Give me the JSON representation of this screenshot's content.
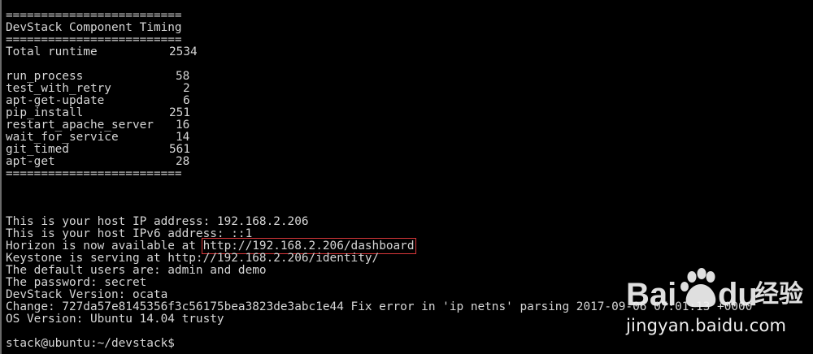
{
  "terminal": {
    "timing": {
      "rule": "=========================",
      "title": "DevStack Component Timing",
      "rows": [
        {
          "label": "Total runtime",
          "value": "2534"
        },
        {
          "label": "run_process",
          "value": "58"
        },
        {
          "label": "test_with_retry",
          "value": "2"
        },
        {
          "label": "apt-get-update",
          "value": "6"
        },
        {
          "label": "pip_install",
          "value": "251"
        },
        {
          "label": "restart_apache_server",
          "value": "16"
        },
        {
          "label": "wait_for_service",
          "value": "14"
        },
        {
          "label": "git_timed",
          "value": "561"
        },
        {
          "label": "apt-get",
          "value": "28"
        }
      ]
    },
    "info": {
      "host_ip": "This is your host IP address: 192.168.2.206",
      "host_ipv6": "This is your host IPv6 address: ::1",
      "horizon_prefix": "Horizon is now available at ",
      "horizon_url": "http://192.168.2.206/dashboard",
      "keystone": "Keystone is serving at http://192.168.2.206/identity/",
      "users": "The default users are: admin and demo",
      "password": "The password: secret",
      "version": "DevStack Version: ocata",
      "change": "Change: 727da57e8145356f3c56175bea3823de3abc1e44 Fix error in 'ip netns' parsing 2017-09-06 07:01:13 +0000",
      "os": "OS Version: Ubuntu 14.04 trusty"
    },
    "prompt": "stack@ubuntu:~/devstack$"
  },
  "watermark": {
    "brand_latin_1": "Bai",
    "brand_latin_2": "du",
    "brand_cn": "经验",
    "url": "jingyan.baidu.com"
  },
  "colors": {
    "background": "#000000",
    "text": "#d6d6d6",
    "highlight_box": "#d8383a"
  }
}
